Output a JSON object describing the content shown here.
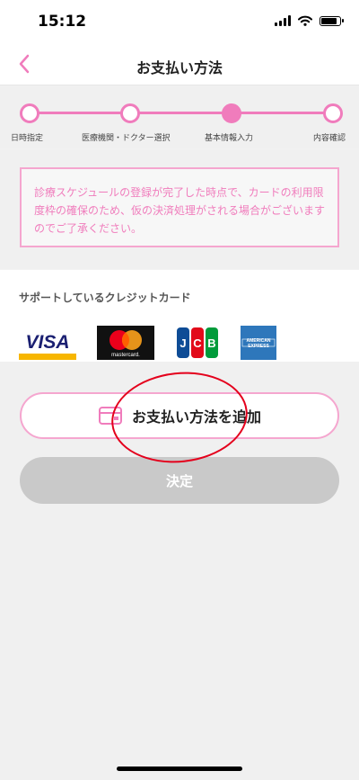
{
  "status_bar": {
    "time": "15:12"
  },
  "nav": {
    "title": "お支払い方法"
  },
  "stepper": {
    "steps": [
      {
        "label": "日時指定",
        "active": false
      },
      {
        "label": "医療機関・ドクター選択",
        "active": false
      },
      {
        "label": "基本情報入力",
        "active": true
      },
      {
        "label": "内容確認",
        "active": false
      }
    ]
  },
  "notice": {
    "text": "診療スケジュールの登録が完了した時点で、カードの利用限度枠の確保のため、仮の決済処理がされる場合がございますのでご了承ください。"
  },
  "cards": {
    "title": "サポートしているクレジットカード",
    "logos": [
      "visa-logo",
      "mastercard-logo",
      "jcb-logo",
      "amex-logo"
    ]
  },
  "buttons": {
    "add_payment": "お支払い方法を追加",
    "decide": "決定"
  },
  "colors": {
    "accent": "#f07cbc",
    "highlight": "#e4001c"
  }
}
